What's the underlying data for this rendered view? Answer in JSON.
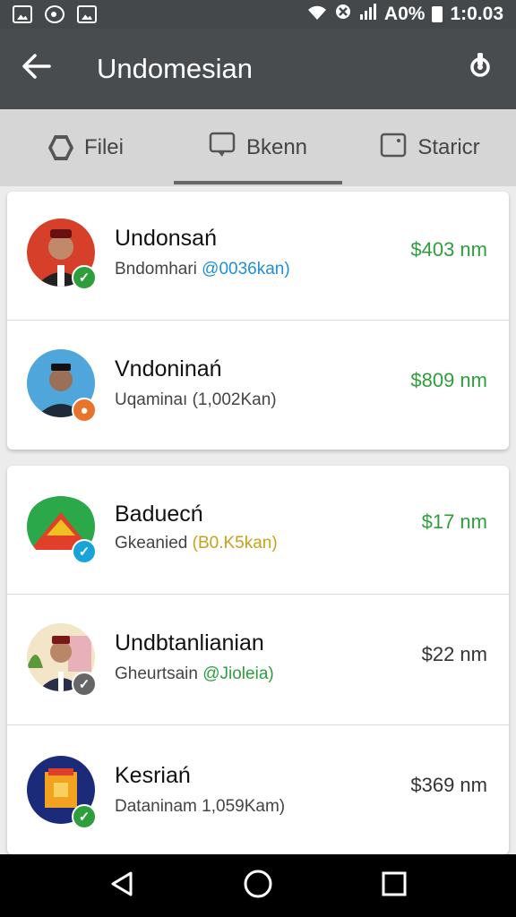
{
  "status_bar": {
    "battery": "A0%",
    "time": "1:0.03"
  },
  "app_bar": {
    "title": "Undomesian",
    "back_icon": "arrow-back-icon",
    "settings_icon": "settings-icon"
  },
  "tabs": [
    {
      "label": "Filei",
      "icon": "hexagon-icon"
    },
    {
      "label": "Bkenn",
      "icon": "chat-icon",
      "active": true
    },
    {
      "label": "Staricr",
      "icon": "box-icon"
    }
  ],
  "items": [
    {
      "name": "Undonsań",
      "sub_prefix": "Bndomhari ",
      "sub_highlight": "@0036kan)",
      "highlight_color": "#1f8fd6",
      "amount": "$403 nm",
      "amount_color": "green",
      "badge": "check",
      "badge_color": "#2e9e3d"
    },
    {
      "name": "Vndoninań",
      "sub_prefix": "Uqaminaı ",
      "sub_highlight": "(1,002Kan)",
      "highlight_color": "#444444",
      "amount": "$809 nm",
      "amount_color": "green",
      "badge": "dot",
      "badge_color": "#e8742c"
    },
    {
      "name": "Baduecń",
      "sub_prefix": "Gkeanied ",
      "sub_highlight": "(B0.K5kan)",
      "highlight_color": "#c8a11a",
      "amount": "$17 nm",
      "amount_color": "green",
      "badge": "check",
      "badge_color": "#1aa3d9"
    },
    {
      "name": "Undbtanlianian",
      "sub_prefix": "Gheurtsain ",
      "sub_highlight": "@Jioleia)",
      "highlight_color": "#2e9e3d",
      "amount": "$22 nm",
      "amount_color": "gray",
      "badge": "check",
      "badge_color": "#666666"
    },
    {
      "name": "Kesriań",
      "sub_prefix": "Dataninam ",
      "sub_highlight": "1,059Kam)",
      "highlight_color": "#444444",
      "amount": "$369 nm",
      "amount_color": "gray",
      "badge": "check",
      "badge_color": "#2e9e3d"
    }
  ],
  "nav_bar": {
    "back_icon": "nav-back-icon",
    "home_icon": "nav-home-icon",
    "recents_icon": "nav-recents-icon"
  }
}
